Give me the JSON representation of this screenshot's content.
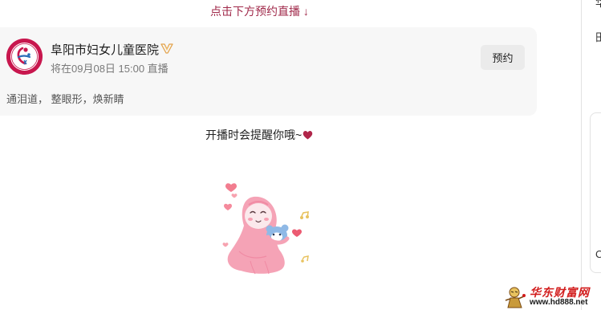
{
  "top_hint": "点击下方预约直播 ↓",
  "live_card": {
    "hospital_name": "阜阳市妇女儿童医院",
    "schedule": "将在09月08日 15:00 直播",
    "reserve_label": "预约",
    "description": "通泪道， 整眼形，焕新睛",
    "avatar_text": "阜阳市妇女儿童医院"
  },
  "reminder": "开播时会提醒你哦~",
  "side": {
    "char1": "华",
    "char2": "田",
    "char3": "C"
  },
  "watermark": {
    "title": "华东财富网",
    "url": "www.hd888.net"
  },
  "colors": {
    "accent": "#a0294a",
    "heart": "#b0264a",
    "avatar_bg": "#c8174e",
    "watermark_red": "#d21c1c"
  },
  "icons": {
    "verify": "verified-badge-icon",
    "heart": "heart-icon"
  }
}
